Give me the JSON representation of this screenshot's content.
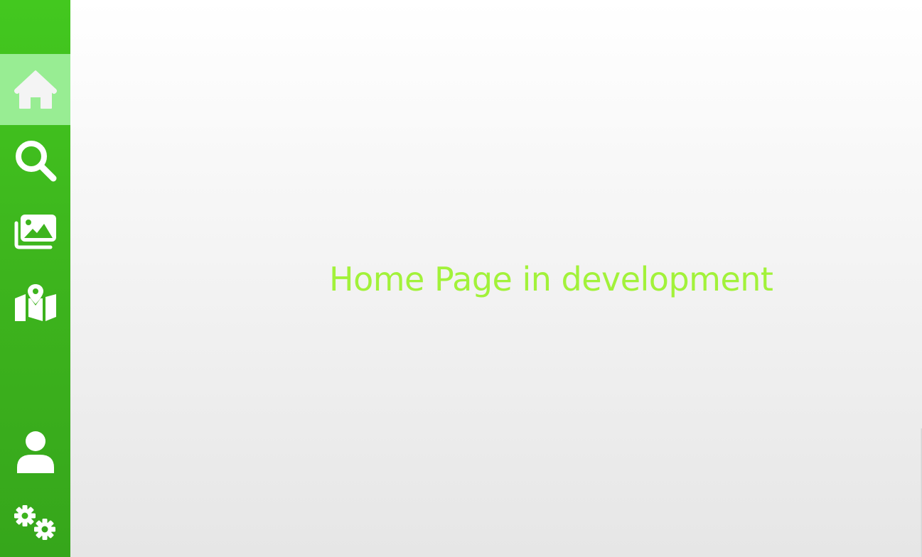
{
  "sidebar": {
    "color_top": "#43c81f",
    "active_highlight": "#98ed93",
    "items": [
      {
        "id": "home",
        "icon": "home-icon",
        "active": true
      },
      {
        "id": "search",
        "icon": "search-icon",
        "active": false
      },
      {
        "id": "gallery",
        "icon": "images-icon",
        "active": false
      },
      {
        "id": "map",
        "icon": "map-icon",
        "active": false
      },
      {
        "id": "profile",
        "icon": "user-icon",
        "active": false
      },
      {
        "id": "settings",
        "icon": "gears-icon",
        "active": false
      }
    ]
  },
  "main": {
    "message": "Home Page in development",
    "message_color": "#a2f23a"
  }
}
